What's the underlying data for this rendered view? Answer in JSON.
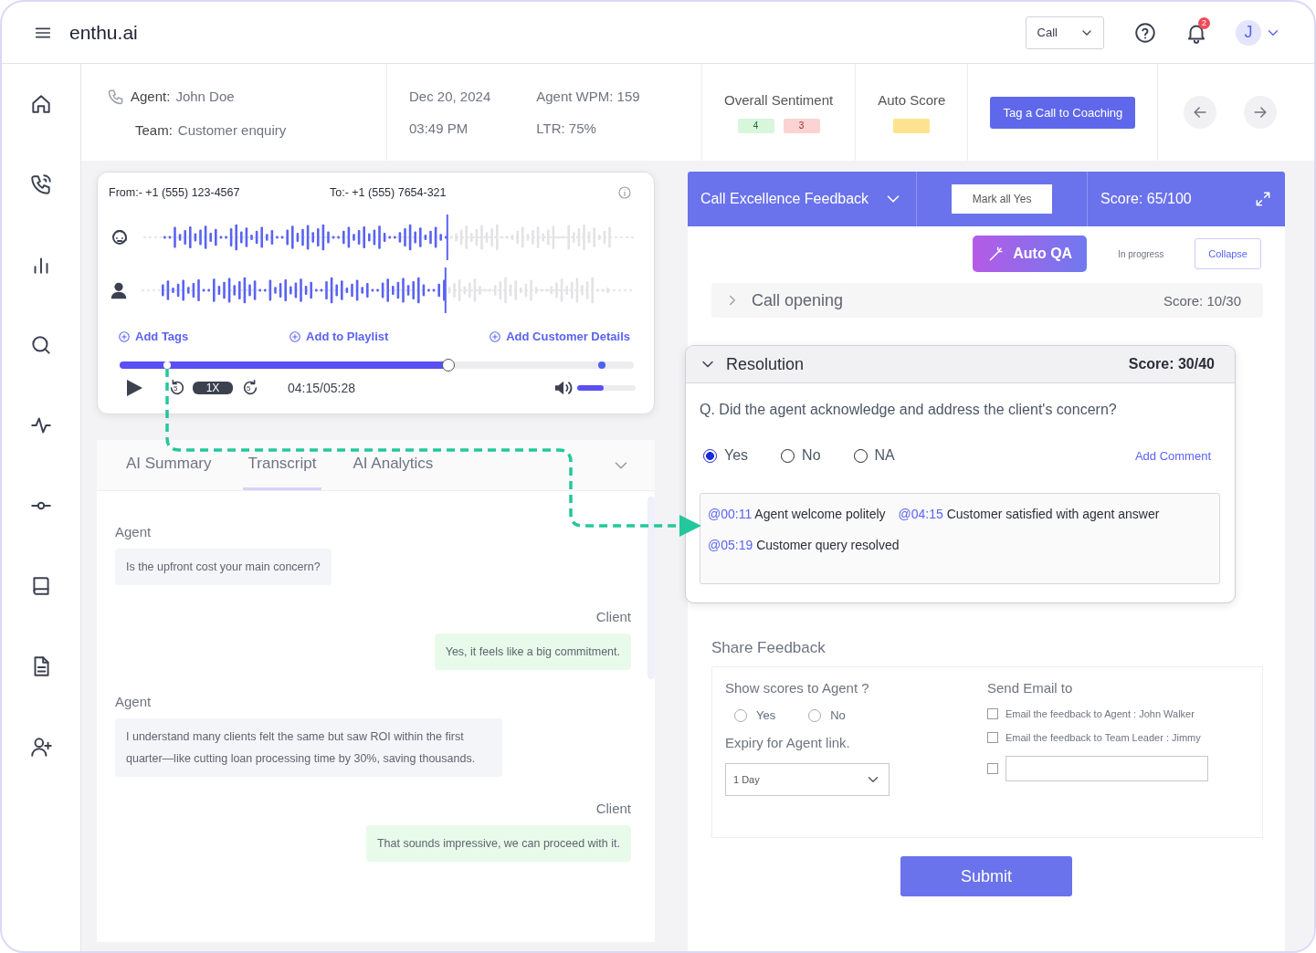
{
  "topbar": {
    "logo": "enthu.ai",
    "call_type": "Call",
    "notifications_count": "2",
    "avatar_initial": "J"
  },
  "call_header": {
    "agent_label": "Agent:",
    "agent": "John Doe",
    "team_label": "Team:",
    "team": "Customer enquiry",
    "date": "Dec 20, 2024",
    "time": "03:49 PM",
    "wpm": "Agent WPM: 159",
    "ltr": "LTR: 75%",
    "sentiment_label": "Overall Sentiment",
    "sentiment_positive": "4",
    "sentiment_negative": "3",
    "auto_score_label": "Auto Score",
    "coaching_button": "Tag a Call to Coaching"
  },
  "player": {
    "from": "From:- +1 (555) 123-4567",
    "to": "To:- +1 (555) 7654-321",
    "actions": [
      "Add Tags",
      "Add to Playlist",
      "Add Customer Details"
    ],
    "progress": {
      "level": 0.64
    },
    "skip_back": "5",
    "speed": "1X",
    "skip_forward": "5",
    "time": "04:15/05:28",
    "volume": {
      "level": 0.45
    }
  },
  "transcript_panel": {
    "tabs": [
      {
        "label": "AI Summary",
        "selected": false
      },
      {
        "label": "Transcript",
        "selected": true
      },
      {
        "label": "AI Analytics",
        "selected": false
      }
    ],
    "messages": [
      {
        "speaker": "Agent",
        "kind": "agent",
        "text": "Is the upfront cost your main concern?"
      },
      {
        "speaker": "Client",
        "kind": "client",
        "text": "Yes, it feels like a big commitment."
      },
      {
        "speaker": "Agent",
        "kind": "agent",
        "text": "I understand many clients felt the same but saw ROI within the first quarter—like cutting loan processing time by 30%, saving thousands."
      },
      {
        "speaker": "Client",
        "kind": "client",
        "text": "That sounds impressive, we can proceed with it."
      }
    ]
  },
  "feedback": {
    "title": "Call Excellence Feedback",
    "mark_all": "Mark all Yes",
    "score": "Score: 65/100",
    "auto_qa": "Auto QA",
    "status": "In progress",
    "collapse": "Collapse",
    "sections": [
      {
        "title": "Call opening",
        "score": "Score: 10/30",
        "expanded": false
      }
    ]
  },
  "resolution": {
    "title": "Resolution",
    "score": "Score: 30/40",
    "expanded": true,
    "question": "Q. Did the agent acknowledge and address the client's concern?",
    "options": [
      {
        "label": "Yes",
        "selected": true
      },
      {
        "label": "No",
        "selected": false
      },
      {
        "label": "NA",
        "selected": false
      }
    ],
    "add_comment": "Add Comment",
    "comments": [
      {
        "time": "@00:11",
        "text": "Agent welcome politely"
      },
      {
        "time": "@04:15",
        "text": "Customer satisfied with agent answer"
      },
      {
        "time": "@05:19",
        "text": "Customer query resolved"
      }
    ]
  },
  "share_feedback": {
    "title": "Share Feedback",
    "show_scores_label": "Show scores to Agent ?",
    "show_scores_options": [
      {
        "label": "Yes",
        "selected": false
      },
      {
        "label": "No",
        "selected": false
      }
    ],
    "expiry_label": "Expiry for Agent link.",
    "expiry_value": "1 Day",
    "send_email_label": "Send Email to",
    "email_options": [
      {
        "label": "Email the feedback to Agent : John Walker",
        "checked": false
      },
      {
        "label": "Email the feedback to Team Leader : Jimmy",
        "checked": false
      }
    ],
    "custom_email": {
      "checked": false
    },
    "submit": "Submit"
  }
}
